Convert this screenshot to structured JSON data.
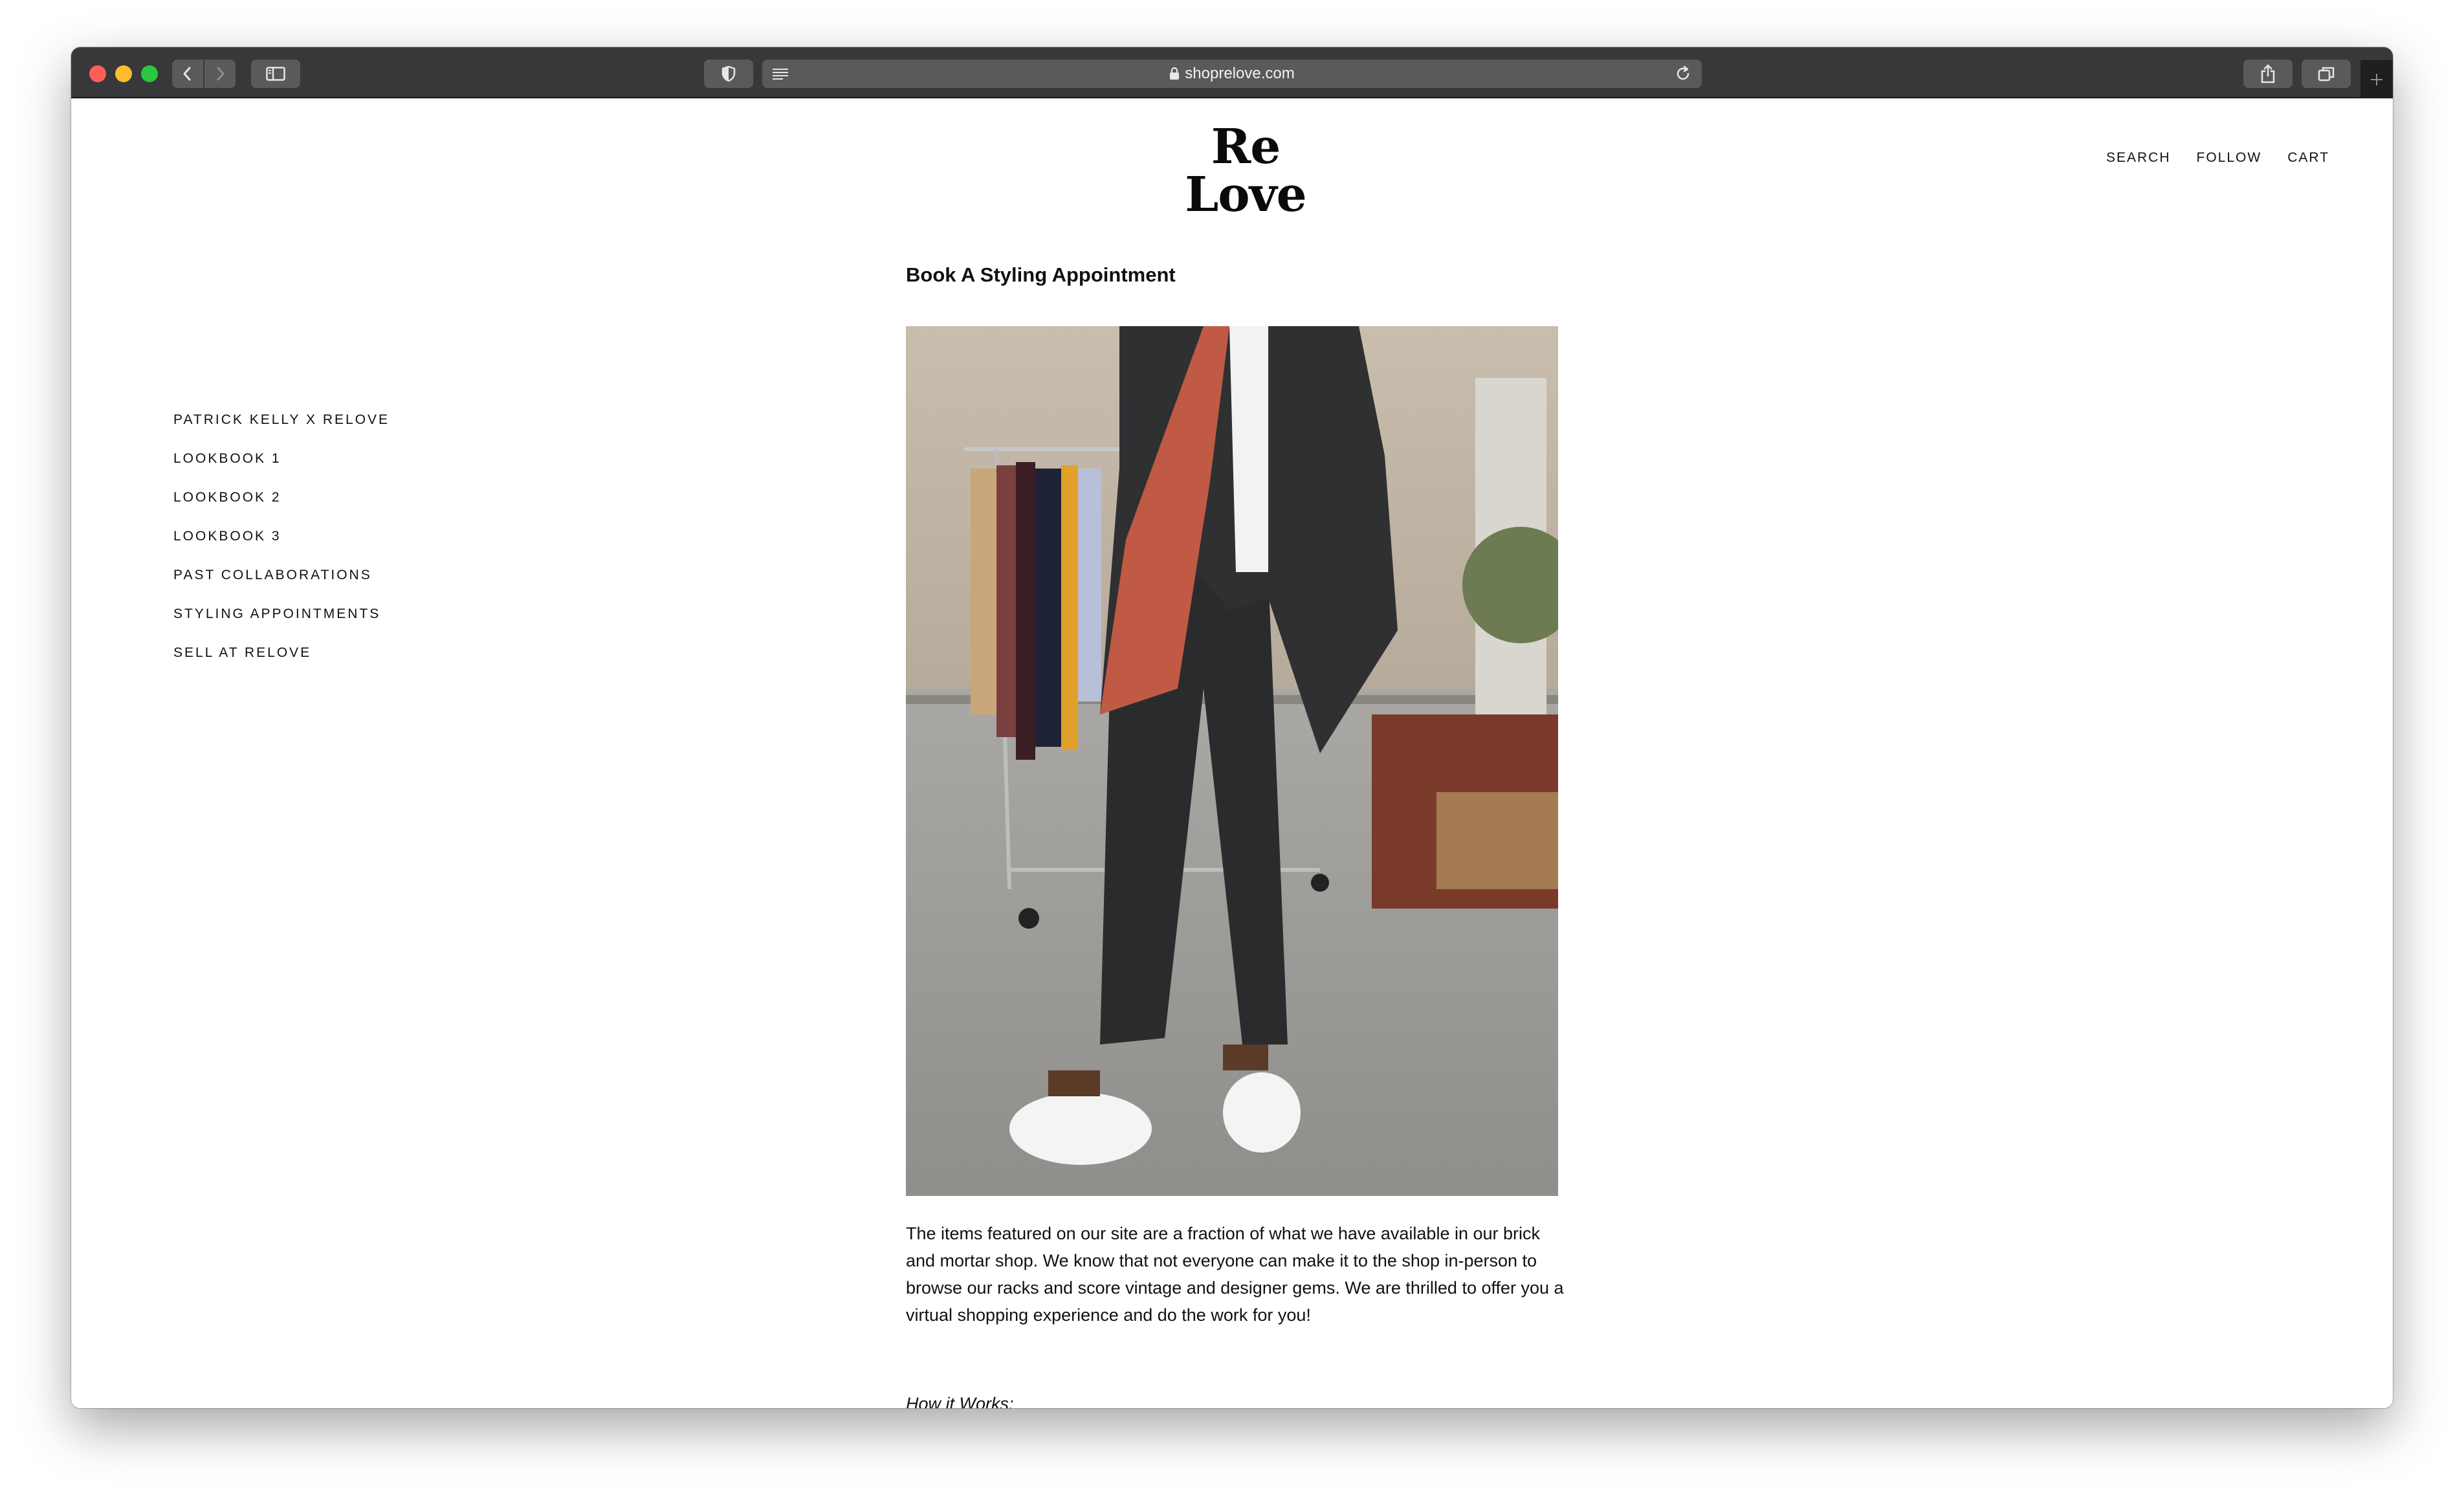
{
  "browser": {
    "url": "shoprelove.com",
    "icons": {
      "back": "chevron-left-icon",
      "forward": "chevron-right-icon",
      "sidebar": "sidebar-icon",
      "shield": "shield-icon",
      "reader": "reader-icon",
      "lock": "lock-icon",
      "reload": "reload-icon",
      "share": "share-icon",
      "tabs": "tabs-overview-icon",
      "new_tab": "plus-icon"
    }
  },
  "site": {
    "logo": "Re Love",
    "top_nav": [
      "SEARCH",
      "FOLLOW",
      "CART"
    ],
    "side_nav": [
      "PATRICK KELLY X RELOVE",
      "LOOKBOOK 1",
      "LOOKBOOK 2",
      "LOOKBOOK 3",
      "PAST COLLABORATIONS",
      "STYLING APPOINTMENTS",
      "SELL AT RELOVE"
    ]
  },
  "main": {
    "title": "Book A Styling Appointment",
    "paragraph": "The items featured on our site are a fraction of what we have available in our brick and mortar shop. We know that not everyone can make it to the shop in-person to browse our racks and score vintage and designer gems. We are thrilled to offer you a virtual shopping experience and do the work for you!",
    "subheading": "How it Works:"
  },
  "colors": {
    "toolbar": "#38383a",
    "close": "#ff5f57",
    "minimize": "#febc2e",
    "zoom": "#28c840",
    "text": "#111111"
  }
}
